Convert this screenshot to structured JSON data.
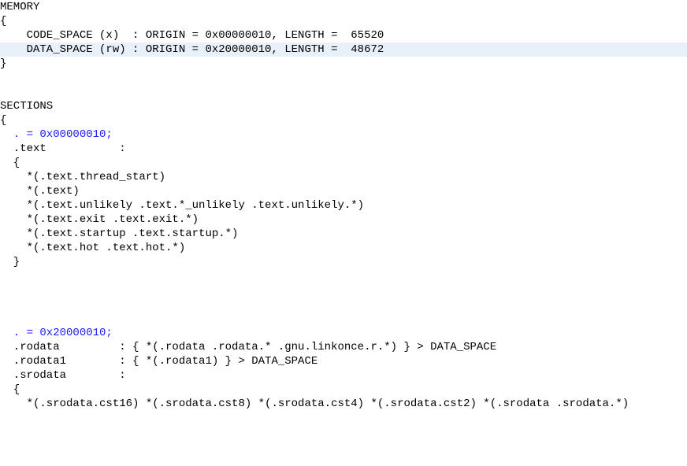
{
  "lines": [
    {
      "t": "MEMORY",
      "cls": ""
    },
    {
      "t": "{",
      "cls": ""
    },
    {
      "t": "    CODE_SPACE (x)  : ORIGIN = 0x00000010, LENGTH =  65520",
      "cls": ""
    },
    {
      "t": "    DATA_SPACE (rw) : ORIGIN = 0x20000010, LENGTH =  48672",
      "cls": "hl"
    },
    {
      "t": "}",
      "cls": ""
    },
    {
      "t": "",
      "cls": ""
    },
    {
      "t": "",
      "cls": ""
    },
    {
      "t": "SECTIONS",
      "cls": ""
    },
    {
      "t": "{",
      "cls": ""
    },
    {
      "t": "  . = 0x00000010;",
      "cls": "blue"
    },
    {
      "t": "  .text           :",
      "cls": ""
    },
    {
      "t": "  {",
      "cls": ""
    },
    {
      "t": "    *(.text.thread_start)",
      "cls": ""
    },
    {
      "t": "    *(.text)",
      "cls": ""
    },
    {
      "t": "    *(.text.unlikely .text.*_unlikely .text.unlikely.*)",
      "cls": ""
    },
    {
      "t": "    *(.text.exit .text.exit.*)",
      "cls": ""
    },
    {
      "t": "    *(.text.startup .text.startup.*)",
      "cls": ""
    },
    {
      "t": "    *(.text.hot .text.hot.*)",
      "cls": ""
    },
    {
      "t": "  }",
      "cls": ""
    },
    {
      "t": "",
      "cls": ""
    },
    {
      "t": "",
      "cls": ""
    },
    {
      "t": "",
      "cls": ""
    },
    {
      "t": "",
      "cls": ""
    },
    {
      "t": "  . = 0x20000010;",
      "cls": "blue"
    },
    {
      "t": "  .rodata         : { *(.rodata .rodata.* .gnu.linkonce.r.*) } > DATA_SPACE",
      "cls": ""
    },
    {
      "t": "  .rodata1        : { *(.rodata1) } > DATA_SPACE",
      "cls": ""
    },
    {
      "t": "  .srodata        :",
      "cls": ""
    },
    {
      "t": "  {",
      "cls": ""
    },
    {
      "t": "    *(.srodata.cst16) *(.srodata.cst8) *(.srodata.cst4) *(.srodata.cst2) *(.srodata .srodata.*)",
      "cls": ""
    }
  ]
}
